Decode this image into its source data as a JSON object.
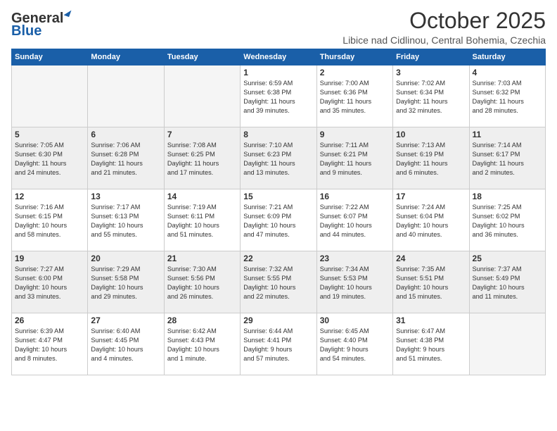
{
  "logo": {
    "general": "General",
    "blue": "Blue"
  },
  "header": {
    "month": "October 2025",
    "location": "Libice nad Cidlinou, Central Bohemia, Czechia"
  },
  "weekdays": [
    "Sunday",
    "Monday",
    "Tuesday",
    "Wednesday",
    "Thursday",
    "Friday",
    "Saturday"
  ],
  "weeks": [
    [
      {
        "day": "",
        "info": ""
      },
      {
        "day": "",
        "info": ""
      },
      {
        "day": "",
        "info": ""
      },
      {
        "day": "1",
        "info": "Sunrise: 6:59 AM\nSunset: 6:38 PM\nDaylight: 11 hours\nand 39 minutes."
      },
      {
        "day": "2",
        "info": "Sunrise: 7:00 AM\nSunset: 6:36 PM\nDaylight: 11 hours\nand 35 minutes."
      },
      {
        "day": "3",
        "info": "Sunrise: 7:02 AM\nSunset: 6:34 PM\nDaylight: 11 hours\nand 32 minutes."
      },
      {
        "day": "4",
        "info": "Sunrise: 7:03 AM\nSunset: 6:32 PM\nDaylight: 11 hours\nand 28 minutes."
      }
    ],
    [
      {
        "day": "5",
        "info": "Sunrise: 7:05 AM\nSunset: 6:30 PM\nDaylight: 11 hours\nand 24 minutes."
      },
      {
        "day": "6",
        "info": "Sunrise: 7:06 AM\nSunset: 6:28 PM\nDaylight: 11 hours\nand 21 minutes."
      },
      {
        "day": "7",
        "info": "Sunrise: 7:08 AM\nSunset: 6:25 PM\nDaylight: 11 hours\nand 17 minutes."
      },
      {
        "day": "8",
        "info": "Sunrise: 7:10 AM\nSunset: 6:23 PM\nDaylight: 11 hours\nand 13 minutes."
      },
      {
        "day": "9",
        "info": "Sunrise: 7:11 AM\nSunset: 6:21 PM\nDaylight: 11 hours\nand 9 minutes."
      },
      {
        "day": "10",
        "info": "Sunrise: 7:13 AM\nSunset: 6:19 PM\nDaylight: 11 hours\nand 6 minutes."
      },
      {
        "day": "11",
        "info": "Sunrise: 7:14 AM\nSunset: 6:17 PM\nDaylight: 11 hours\nand 2 minutes."
      }
    ],
    [
      {
        "day": "12",
        "info": "Sunrise: 7:16 AM\nSunset: 6:15 PM\nDaylight: 10 hours\nand 58 minutes."
      },
      {
        "day": "13",
        "info": "Sunrise: 7:17 AM\nSunset: 6:13 PM\nDaylight: 10 hours\nand 55 minutes."
      },
      {
        "day": "14",
        "info": "Sunrise: 7:19 AM\nSunset: 6:11 PM\nDaylight: 10 hours\nand 51 minutes."
      },
      {
        "day": "15",
        "info": "Sunrise: 7:21 AM\nSunset: 6:09 PM\nDaylight: 10 hours\nand 47 minutes."
      },
      {
        "day": "16",
        "info": "Sunrise: 7:22 AM\nSunset: 6:07 PM\nDaylight: 10 hours\nand 44 minutes."
      },
      {
        "day": "17",
        "info": "Sunrise: 7:24 AM\nSunset: 6:04 PM\nDaylight: 10 hours\nand 40 minutes."
      },
      {
        "day": "18",
        "info": "Sunrise: 7:25 AM\nSunset: 6:02 PM\nDaylight: 10 hours\nand 36 minutes."
      }
    ],
    [
      {
        "day": "19",
        "info": "Sunrise: 7:27 AM\nSunset: 6:00 PM\nDaylight: 10 hours\nand 33 minutes."
      },
      {
        "day": "20",
        "info": "Sunrise: 7:29 AM\nSunset: 5:58 PM\nDaylight: 10 hours\nand 29 minutes."
      },
      {
        "day": "21",
        "info": "Sunrise: 7:30 AM\nSunset: 5:56 PM\nDaylight: 10 hours\nand 26 minutes."
      },
      {
        "day": "22",
        "info": "Sunrise: 7:32 AM\nSunset: 5:55 PM\nDaylight: 10 hours\nand 22 minutes."
      },
      {
        "day": "23",
        "info": "Sunrise: 7:34 AM\nSunset: 5:53 PM\nDaylight: 10 hours\nand 19 minutes."
      },
      {
        "day": "24",
        "info": "Sunrise: 7:35 AM\nSunset: 5:51 PM\nDaylight: 10 hours\nand 15 minutes."
      },
      {
        "day": "25",
        "info": "Sunrise: 7:37 AM\nSunset: 5:49 PM\nDaylight: 10 hours\nand 11 minutes."
      }
    ],
    [
      {
        "day": "26",
        "info": "Sunrise: 6:39 AM\nSunset: 4:47 PM\nDaylight: 10 hours\nand 8 minutes."
      },
      {
        "day": "27",
        "info": "Sunrise: 6:40 AM\nSunset: 4:45 PM\nDaylight: 10 hours\nand 4 minutes."
      },
      {
        "day": "28",
        "info": "Sunrise: 6:42 AM\nSunset: 4:43 PM\nDaylight: 10 hours\nand 1 minute."
      },
      {
        "day": "29",
        "info": "Sunrise: 6:44 AM\nSunset: 4:41 PM\nDaylight: 9 hours\nand 57 minutes."
      },
      {
        "day": "30",
        "info": "Sunrise: 6:45 AM\nSunset: 4:40 PM\nDaylight: 9 hours\nand 54 minutes."
      },
      {
        "day": "31",
        "info": "Sunrise: 6:47 AM\nSunset: 4:38 PM\nDaylight: 9 hours\nand 51 minutes."
      },
      {
        "day": "",
        "info": ""
      }
    ]
  ]
}
